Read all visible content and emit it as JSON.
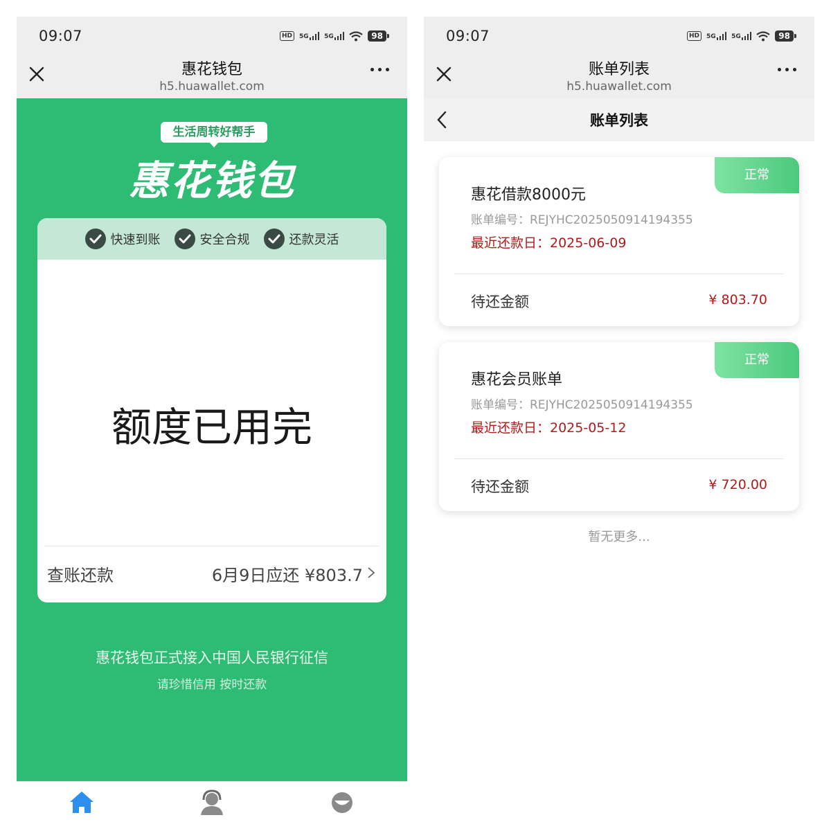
{
  "status_bar": {
    "time": "09:07",
    "battery": "98",
    "hd": "HD",
    "net1": "5G",
    "net2": "5G"
  },
  "left": {
    "nav_title": "惠花钱包",
    "nav_sub": "h5.huawallet.com",
    "slogan": "生活周转好帮手",
    "brand": "惠花钱包",
    "features": [
      "快速到账",
      "安全合规",
      "还款灵活"
    ],
    "quota_message": "额度已用完",
    "repay_label": "查账还款",
    "repay_info": "6月9日应还 ¥803.7",
    "notice_main": "惠花钱包正式接入中国人民银行征信",
    "notice_sub": "请珍惜信用 按时还款",
    "tabs": [
      "home-icon",
      "customer-service-icon",
      "profile-icon"
    ]
  },
  "right": {
    "nav_title": "账单列表",
    "nav_sub": "h5.huawallet.com",
    "page_title": "账单列表",
    "bills": [
      {
        "status": "正常",
        "title": "惠花借款8000元",
        "bill_no": "账单编号：REJYHC2025050914194355",
        "due_date": "最近还款日：2025-06-09",
        "amount_label": "待还金额",
        "amount": "¥ 803.70"
      },
      {
        "status": "正常",
        "title": "惠花会员账单",
        "bill_no": "账单编号：REJYHC2025050914194355",
        "due_date": "最近还款日：2025-05-12",
        "amount_label": "待还金额",
        "amount": "¥ 720.00"
      }
    ],
    "no_more": "暂无更多..."
  },
  "colors": {
    "brand_green": "#2ebb73",
    "feature_bar": "#c4e8d5",
    "due_red": "#b01a1a",
    "badge_green": "#4cc97d",
    "tab_active": "#2e8ef0"
  }
}
